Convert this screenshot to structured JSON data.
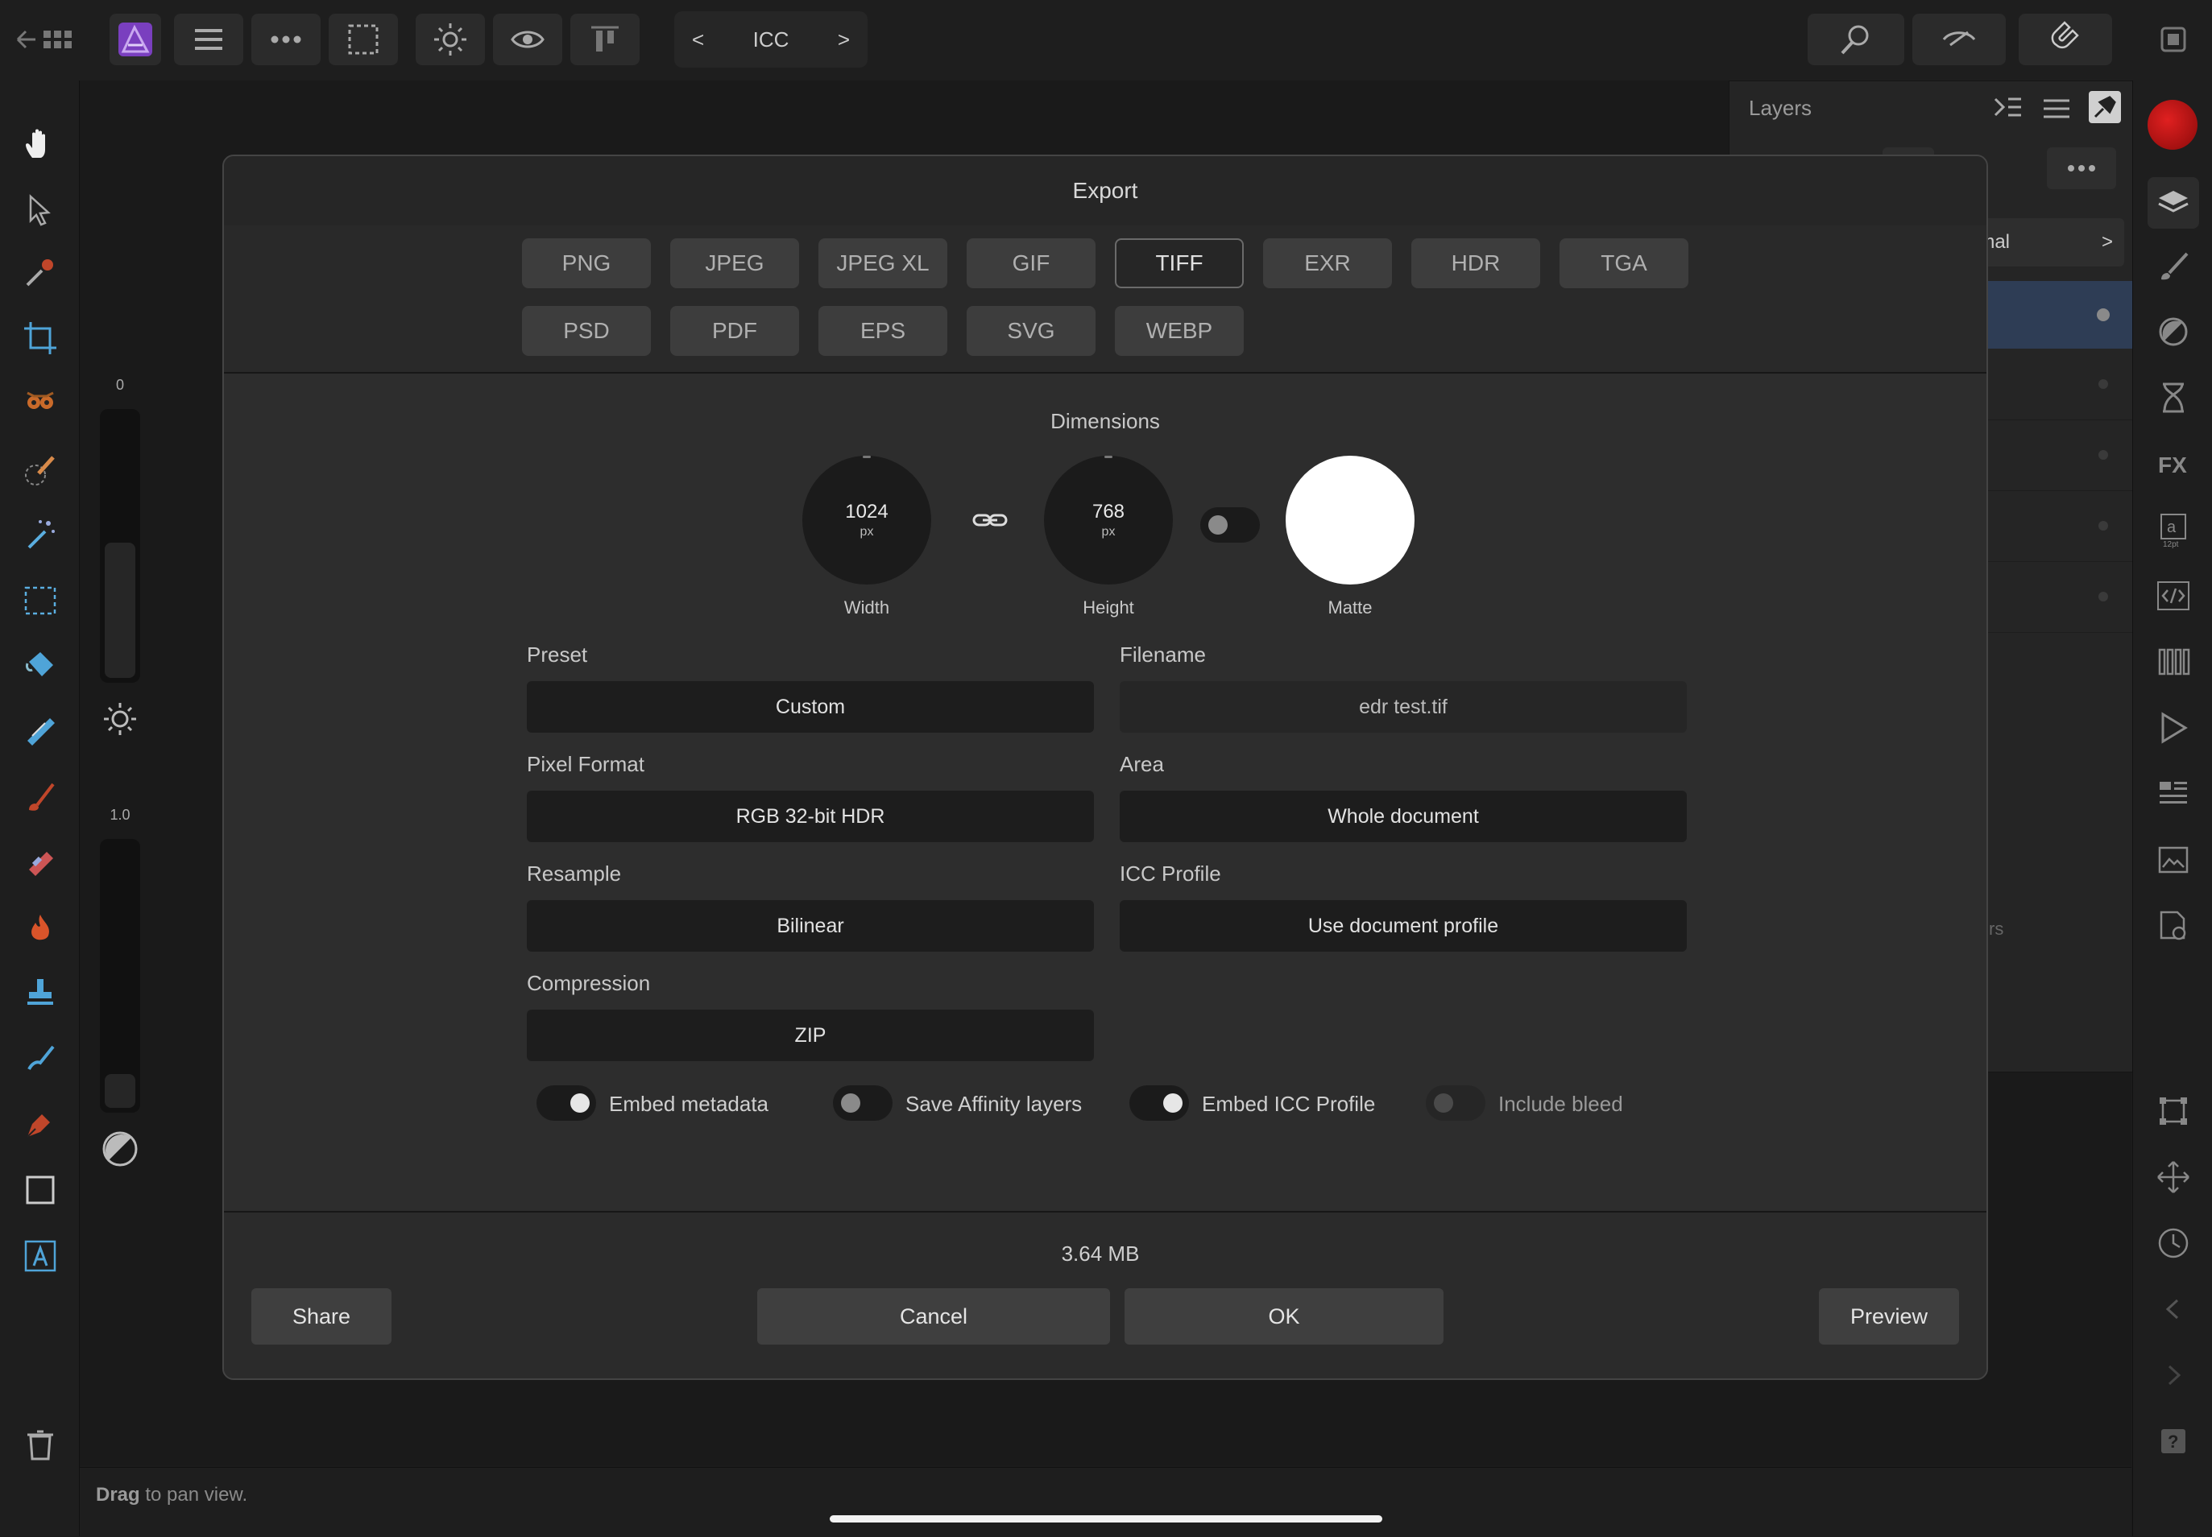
{
  "toolbar": {
    "doc_name": "ICC",
    "prev": "<",
    "next": ">"
  },
  "left_rail": {
    "top_value": "0",
    "mid_value": "1.0"
  },
  "layers": {
    "title": "Layers",
    "blend_mode": "ormal",
    "fragment": "rs"
  },
  "status": {
    "bold": "Drag",
    "rest": "to pan view."
  },
  "dialog": {
    "title": "Export",
    "formats_row1": [
      "PNG",
      "JPEG",
      "JPEG XL",
      "GIF",
      "TIFF",
      "EXR",
      "HDR",
      "TGA"
    ],
    "formats_row2": [
      "PSD",
      "PDF",
      "EPS",
      "SVG",
      "WEBP"
    ],
    "selected_format": "TIFF",
    "dimensions": {
      "label": "Dimensions",
      "width": {
        "value": "1024",
        "unit": "px",
        "label": "Width"
      },
      "height": {
        "value": "768",
        "unit": "px",
        "label": "Height"
      },
      "matte_label": "Matte",
      "matte_color": "#ffffff"
    },
    "fields": {
      "preset": {
        "label": "Preset",
        "value": "Custom"
      },
      "filename": {
        "label": "Filename",
        "value": "edr test.tif"
      },
      "pixel_format": {
        "label": "Pixel Format",
        "value": "RGB 32-bit HDR"
      },
      "area": {
        "label": "Area",
        "value": "Whole document"
      },
      "resample": {
        "label": "Resample",
        "value": "Bilinear"
      },
      "icc_profile": {
        "label": "ICC Profile",
        "value": "Use document profile"
      },
      "compression": {
        "label": "Compression",
        "value": "ZIP"
      }
    },
    "toggles": [
      {
        "label": "Embed metadata",
        "on": true
      },
      {
        "label": "Save Affinity layers",
        "on": false
      },
      {
        "label": "Embed ICC Profile",
        "on": true
      },
      {
        "label": "Include bleed",
        "on": false,
        "disabled": true
      }
    ],
    "file_size": "3.64 MB",
    "buttons": {
      "share": "Share",
      "cancel": "Cancel",
      "ok": "OK",
      "preview": "Preview"
    }
  },
  "colors": {
    "accent": "#7a3fbf",
    "record": "#c0181a",
    "layer_selected": "#2e3d55"
  }
}
